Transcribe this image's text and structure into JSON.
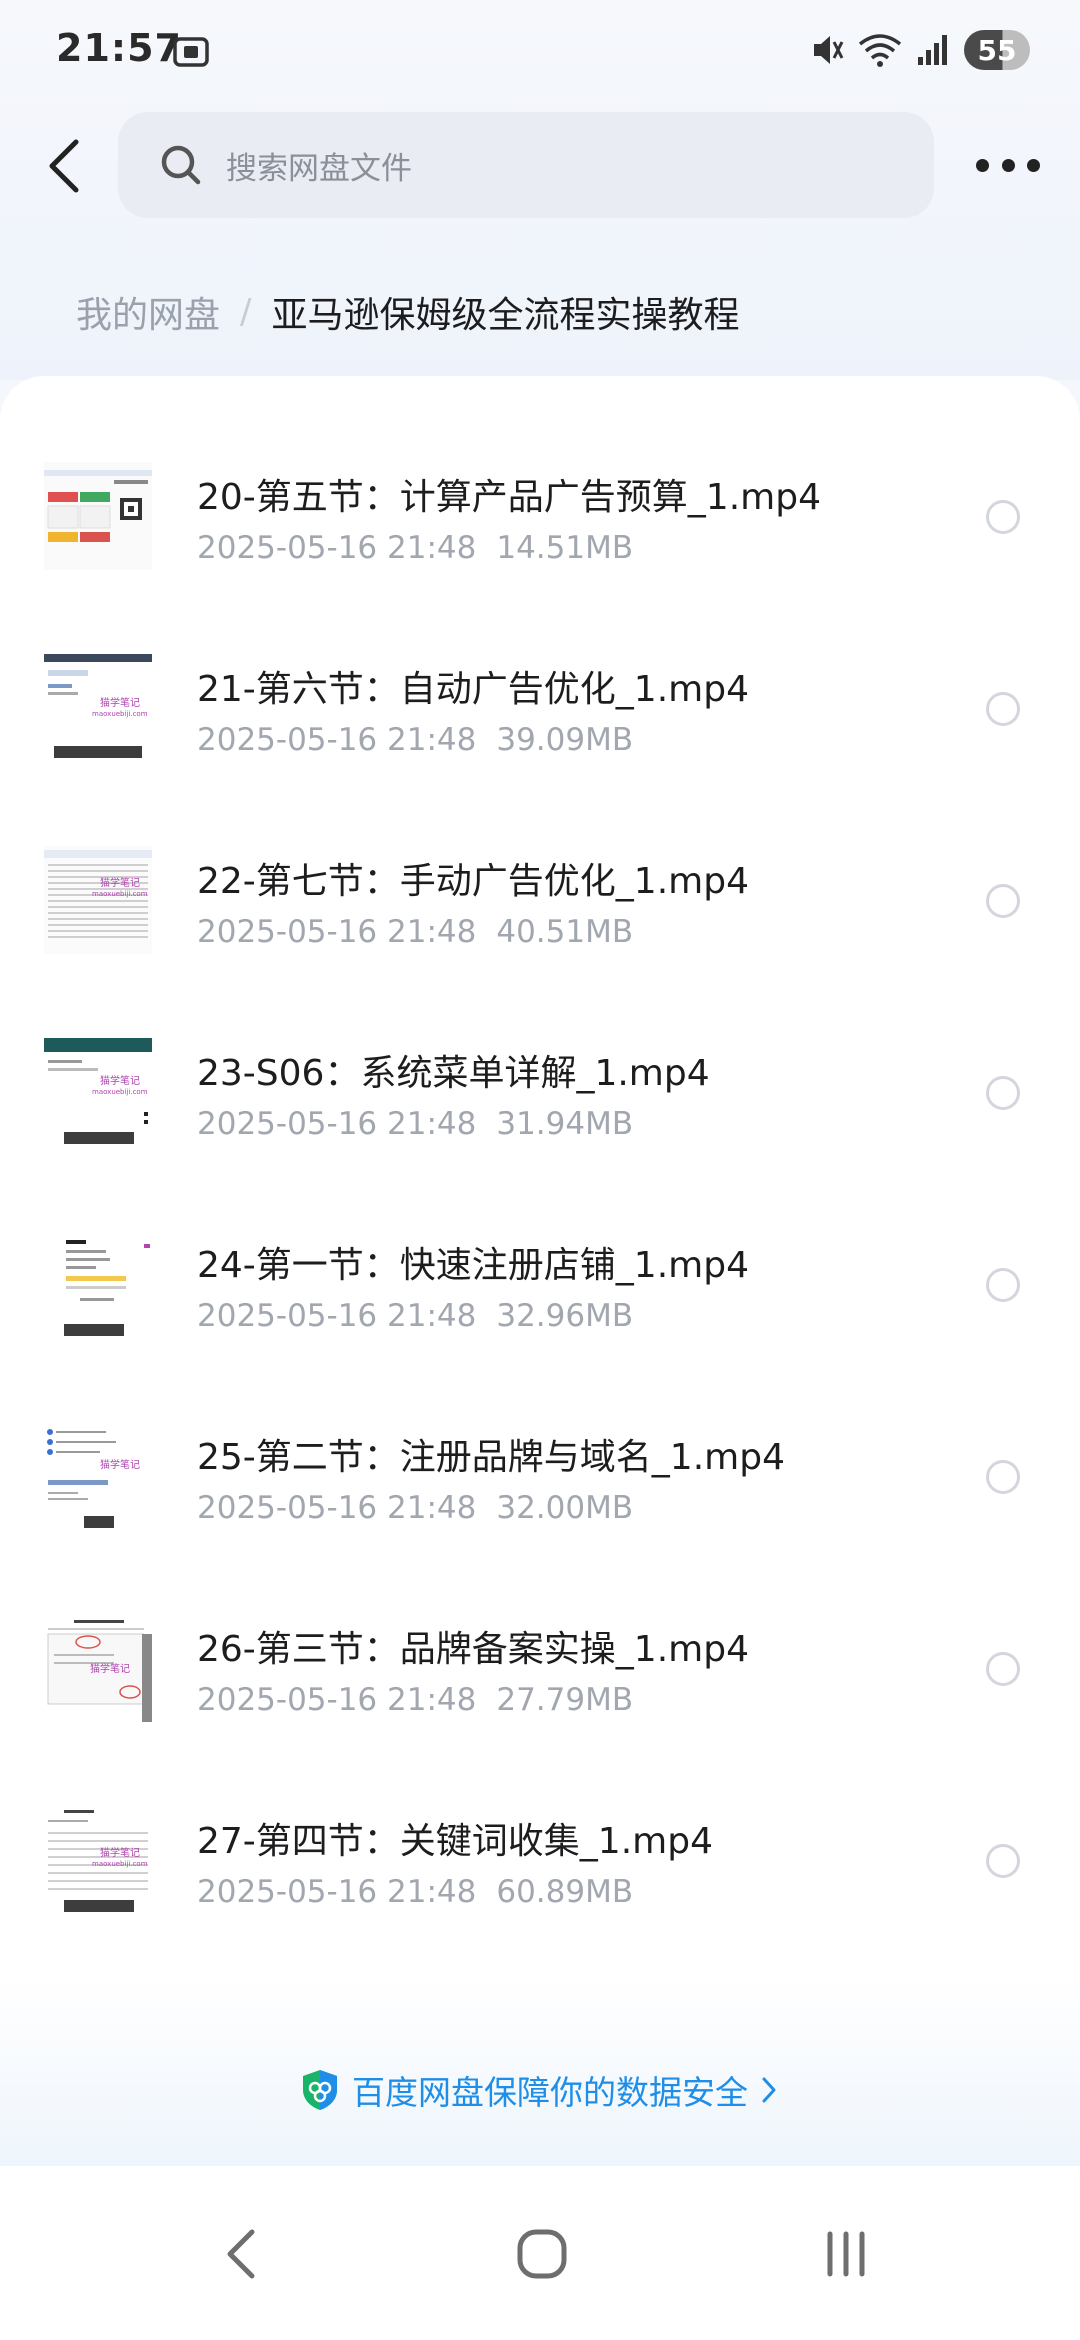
{
  "status_bar": {
    "time": "21:57",
    "battery": "55",
    "icons": [
      "screenshot-icon",
      "mute-icon",
      "wifi-icon",
      "signal-icon",
      "battery-icon"
    ]
  },
  "header": {
    "search_placeholder": "搜索网盘文件",
    "back_icon": "back-arrow-icon",
    "more_icon": "more-icon"
  },
  "breadcrumb": {
    "root": "我的网盘",
    "separator": "/",
    "current": "亚马逊保姆级全流程实操教程"
  },
  "files": [
    {
      "name": "20-第五节：计算产品广告预算_1.mp4",
      "date": "2025-05-16  21:48",
      "size": "14.51MB",
      "thumb_caption": ""
    },
    {
      "name": "21-第六节：自动广告优化_1.mp4",
      "date": "2025-05-16  21:48",
      "size": "39.09MB",
      "thumb_caption": "都不可能再出现我们的产品"
    },
    {
      "name": "22-第七节：手动广告优化_1.mp4",
      "date": "2025-05-16  21:48",
      "size": "40.51MB",
      "thumb_caption": ""
    },
    {
      "name": "23-S06：系统菜单详解_1.mp4",
      "date": "2025-05-16  21:48",
      "size": "31.94MB",
      "thumb_caption": "有的人他哦30多也行"
    },
    {
      "name": "24-第一节：快速注册店铺_1.mp4",
      "date": "2025-05-16  21:48",
      "size": "32.96MB",
      "thumb_caption": "这样子会比较好"
    },
    {
      "name": "25-第二节：注册品牌与域名_1.mp4",
      "date": "2025-05-16  21:48",
      "size": "32.00MB",
      "thumb_caption": "总得了吗"
    },
    {
      "name": "26-第三节：品牌备案实操_1.mp4",
      "date": "2025-05-16  21:48",
      "size": "27.79MB",
      "thumb_caption": ""
    },
    {
      "name": "27-第四节：关键词收集_1.mp4",
      "date": "2025-05-16  21:48",
      "size": "60.89MB",
      "thumb_caption": "可以每一个都看过去"
    }
  ],
  "footer": {
    "security_text": "百度网盘保障你的数据安全"
  },
  "colors": {
    "accent": "#1f8ee8",
    "text_primary": "#1d1d1f",
    "text_secondary": "#a1a6af",
    "search_bg": "#e9ecf3"
  }
}
